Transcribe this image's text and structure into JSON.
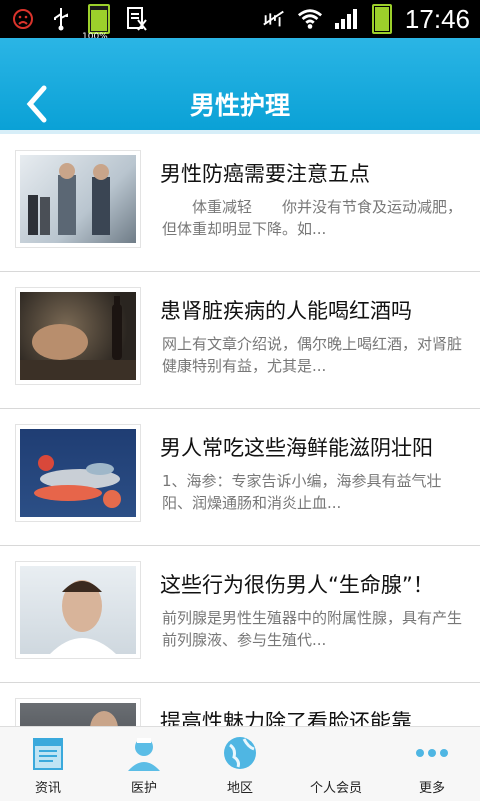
{
  "status_bar": {
    "battery_label": "100%",
    "time": "17:46",
    "icons": [
      "sad-face-icon",
      "usb-icon",
      "battery-icon",
      "notification-icon",
      "mute-icon",
      "wifi-icon",
      "signal-icon",
      "battery-icon"
    ]
  },
  "header": {
    "title": "男性护理",
    "back_icon": "chevron-left-icon",
    "accent": "#12a9dd"
  },
  "articles": [
    {
      "title": "男性防癌需要注意五点",
      "summary": "　　体重减轻　　你并没有节食及运动减肥，但体重却明显下降。如..."
    },
    {
      "title": "患肾脏疾病的人能喝红酒吗",
      "summary": "网上有文章介绍说，偶尔晚上喝红酒，对肾脏健康特别有益，尤其是..."
    },
    {
      "title": "男人常吃这些海鲜能滋阴壮阳",
      "summary": "1、海参：专家告诉小编，海参具有益气壮阳、润燥通肠和消炎止血..."
    },
    {
      "title": "这些行为很伤男人“生命腺”！",
      "summary": "前列腺是男性生殖器中的附属性腺，具有产生前列腺液、参与生殖代..."
    },
    {
      "title": "提高性魅力除了看脸还能靠",
      "summary": ""
    }
  ],
  "tabs": [
    {
      "label": "资讯",
      "icon": "news-icon"
    },
    {
      "label": "医护",
      "icon": "doctor-icon"
    },
    {
      "label": "地区",
      "icon": "globe-icon"
    },
    {
      "label": "个人会员",
      "icon": "member-icon"
    },
    {
      "label": "更多",
      "icon": "more-icon"
    }
  ]
}
